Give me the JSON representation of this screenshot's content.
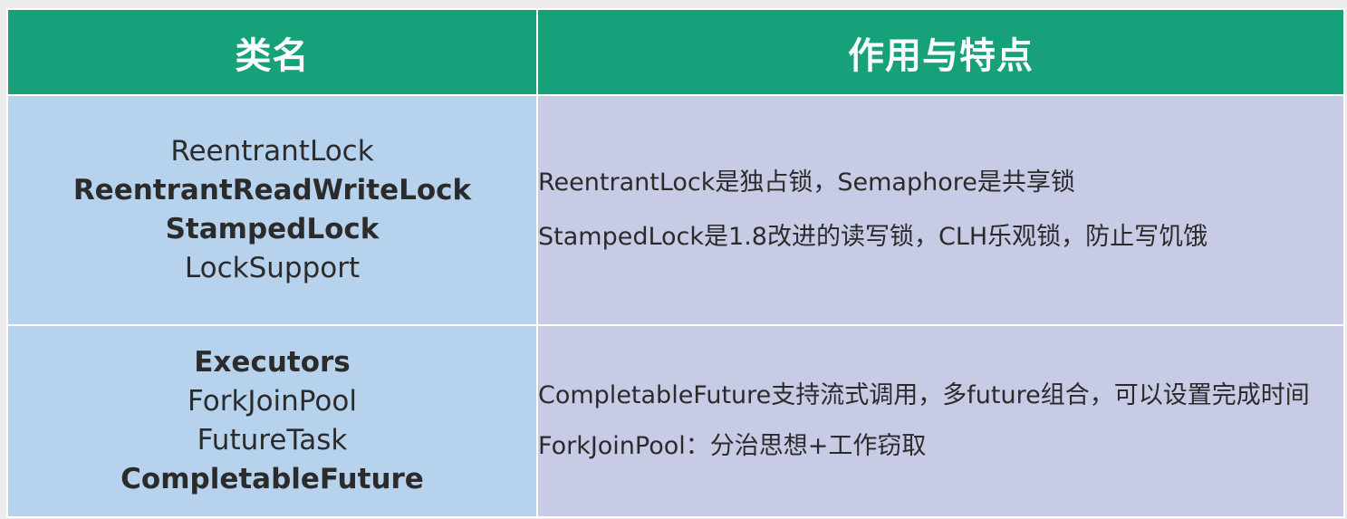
{
  "headers": {
    "col1": "类名",
    "col2": "作用与特点"
  },
  "rows": [
    {
      "names": [
        {
          "text": "ReentrantLock",
          "bold": false
        },
        {
          "text": "ReentrantReadWriteLock",
          "bold": true
        },
        {
          "text": "StampedLock",
          "bold": true
        },
        {
          "text": "LockSupport",
          "bold": false
        }
      ],
      "desc": [
        "ReentrantLock是独占锁，Semaphore是共享锁",
        "StampedLock是1.8改进的读写锁，CLH乐观锁，防止写饥饿"
      ]
    },
    {
      "names": [
        {
          "text": "Executors",
          "bold": true
        },
        {
          "text": "ForkJoinPool",
          "bold": false
        },
        {
          "text": "FutureTask",
          "bold": false
        },
        {
          "text": "CompletableFuture",
          "bold": true
        }
      ],
      "desc": [
        "CompletableFuture支持流式调用，多future组合，可以设置完成时间",
        "ForkJoinPool：分治思想+工作窃取"
      ]
    }
  ],
  "colors": {
    "header_bg": "#16a17a",
    "names_bg": "#b7d2ec",
    "desc_bg": "#c8cbe6"
  }
}
